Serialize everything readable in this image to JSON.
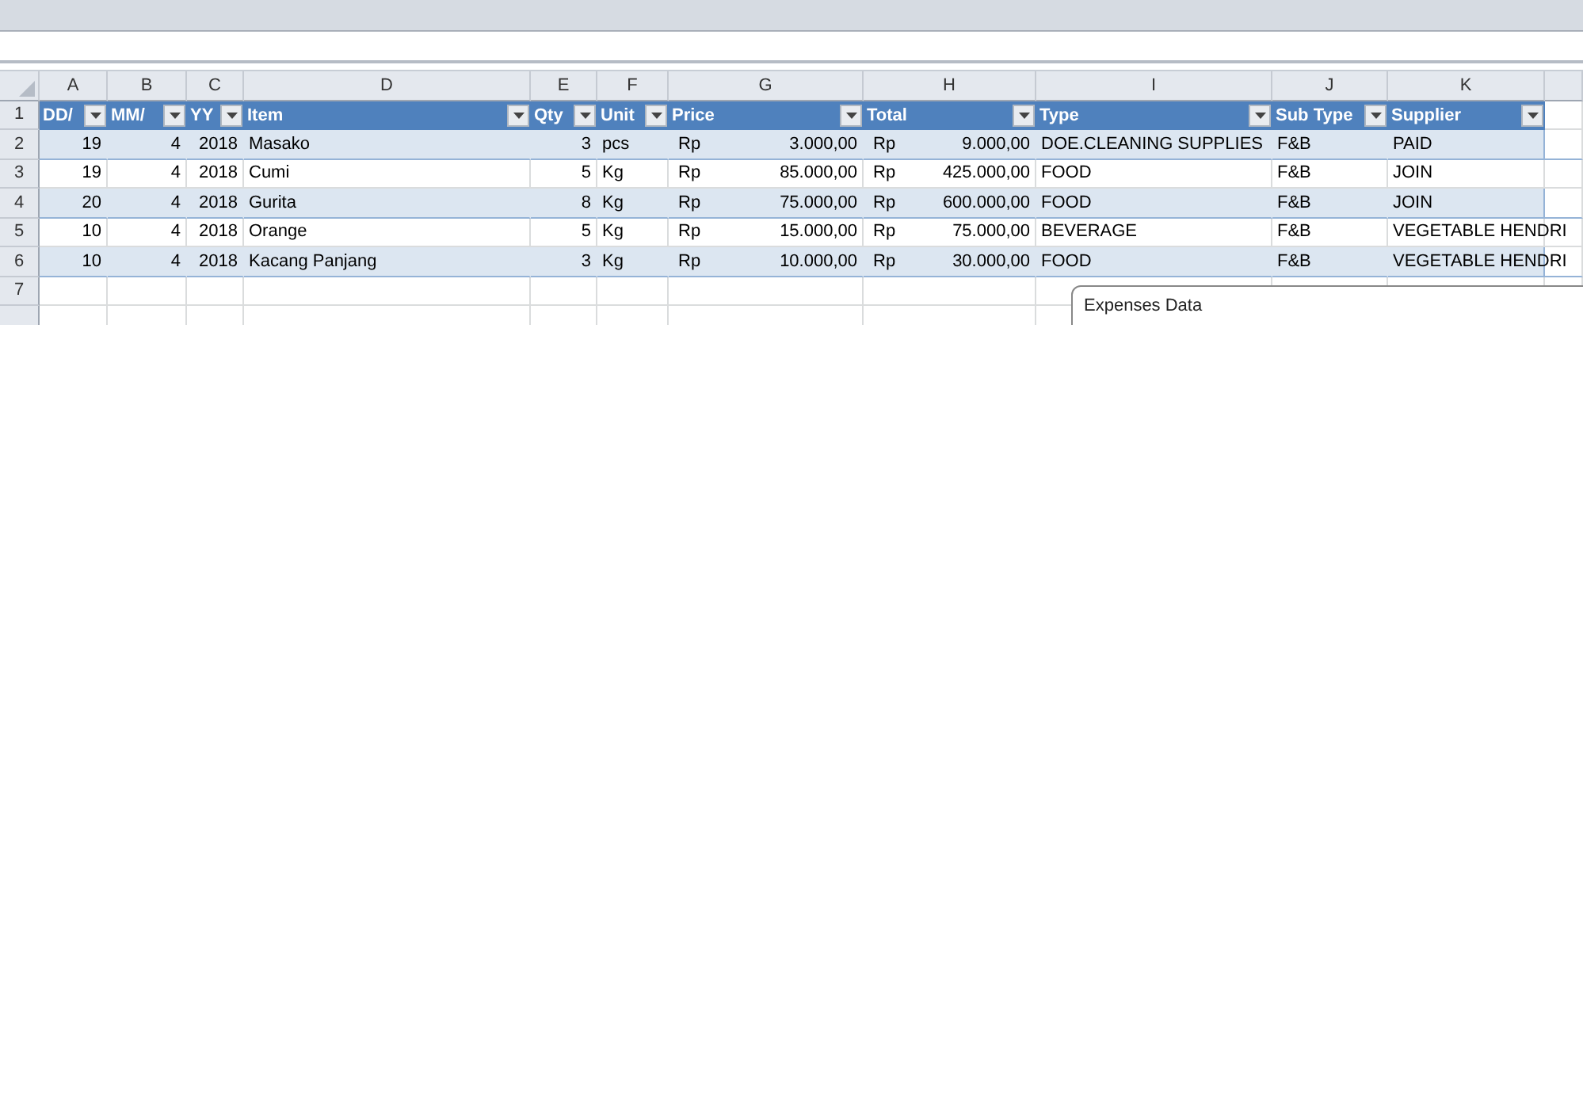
{
  "column_letters": [
    "A",
    "B",
    "C",
    "D",
    "E",
    "F",
    "G",
    "H",
    "I",
    "J",
    "K"
  ],
  "table": {
    "headers": [
      {
        "label": "DD/",
        "filter": true
      },
      {
        "label": "MM/",
        "filter": true
      },
      {
        "label": "YY",
        "filter": true
      },
      {
        "label": "Item",
        "filter": true
      },
      {
        "label": "Qty",
        "filter": true
      },
      {
        "label": "Unit",
        "filter": true
      },
      {
        "label": "Price",
        "filter": true
      },
      {
        "label": "Total",
        "filter": true
      },
      {
        "label": "Type",
        "filter": true
      },
      {
        "label": "Sub Type",
        "filter": true
      },
      {
        "label": "Supplier",
        "filter": true
      }
    ],
    "header_row_number": "1",
    "rows": [
      {
        "row_number": "2",
        "dd": "19",
        "mm": "4",
        "yy": "2018",
        "item": "Masako",
        "qty": "3",
        "unit": "pcs",
        "price": {
          "currency": "Rp",
          "amount": "3.000,00"
        },
        "total": {
          "currency": "Rp",
          "amount": "9.000,00"
        },
        "type": "DOE.CLEANING SUPPLIES",
        "sub_type": "F&B",
        "supplier": "PAID"
      },
      {
        "row_number": "3",
        "dd": "19",
        "mm": "4",
        "yy": "2018",
        "item": "Cumi",
        "qty": "5",
        "unit": "Kg",
        "price": {
          "currency": "Rp",
          "amount": "85.000,00"
        },
        "total": {
          "currency": "Rp",
          "amount": "425.000,00"
        },
        "type": "FOOD",
        "sub_type": "F&B",
        "supplier": "JOIN"
      },
      {
        "row_number": "4",
        "dd": "20",
        "mm": "4",
        "yy": "2018",
        "item": "Gurita",
        "qty": "8",
        "unit": "Kg",
        "price": {
          "currency": "Rp",
          "amount": "75.000,00"
        },
        "total": {
          "currency": "Rp",
          "amount": "600.000,00"
        },
        "type": "FOOD",
        "sub_type": "F&B",
        "supplier": "JOIN"
      },
      {
        "row_number": "5",
        "dd": "10",
        "mm": "4",
        "yy": "2018",
        "item": "Orange",
        "qty": "5",
        "unit": "Kg",
        "price": {
          "currency": "Rp",
          "amount": "15.000,00"
        },
        "total": {
          "currency": "Rp",
          "amount": "75.000,00"
        },
        "type": "BEVERAGE",
        "sub_type": "F&B",
        "supplier": "VEGETABLE HENDRI"
      },
      {
        "row_number": "6",
        "dd": "10",
        "mm": "4",
        "yy": "2018",
        "item": "Kacang Panjang",
        "qty": "3",
        "unit": "Kg",
        "price": {
          "currency": "Rp",
          "amount": "10.000,00"
        },
        "total": {
          "currency": "Rp",
          "amount": "30.000,00"
        },
        "type": "FOOD",
        "sub_type": "F&B",
        "supplier": "VEGETABLE HENDRI"
      }
    ]
  },
  "empty_rows": [
    "7",
    ""
  ],
  "chart": {
    "title": "Expenses Data"
  }
}
